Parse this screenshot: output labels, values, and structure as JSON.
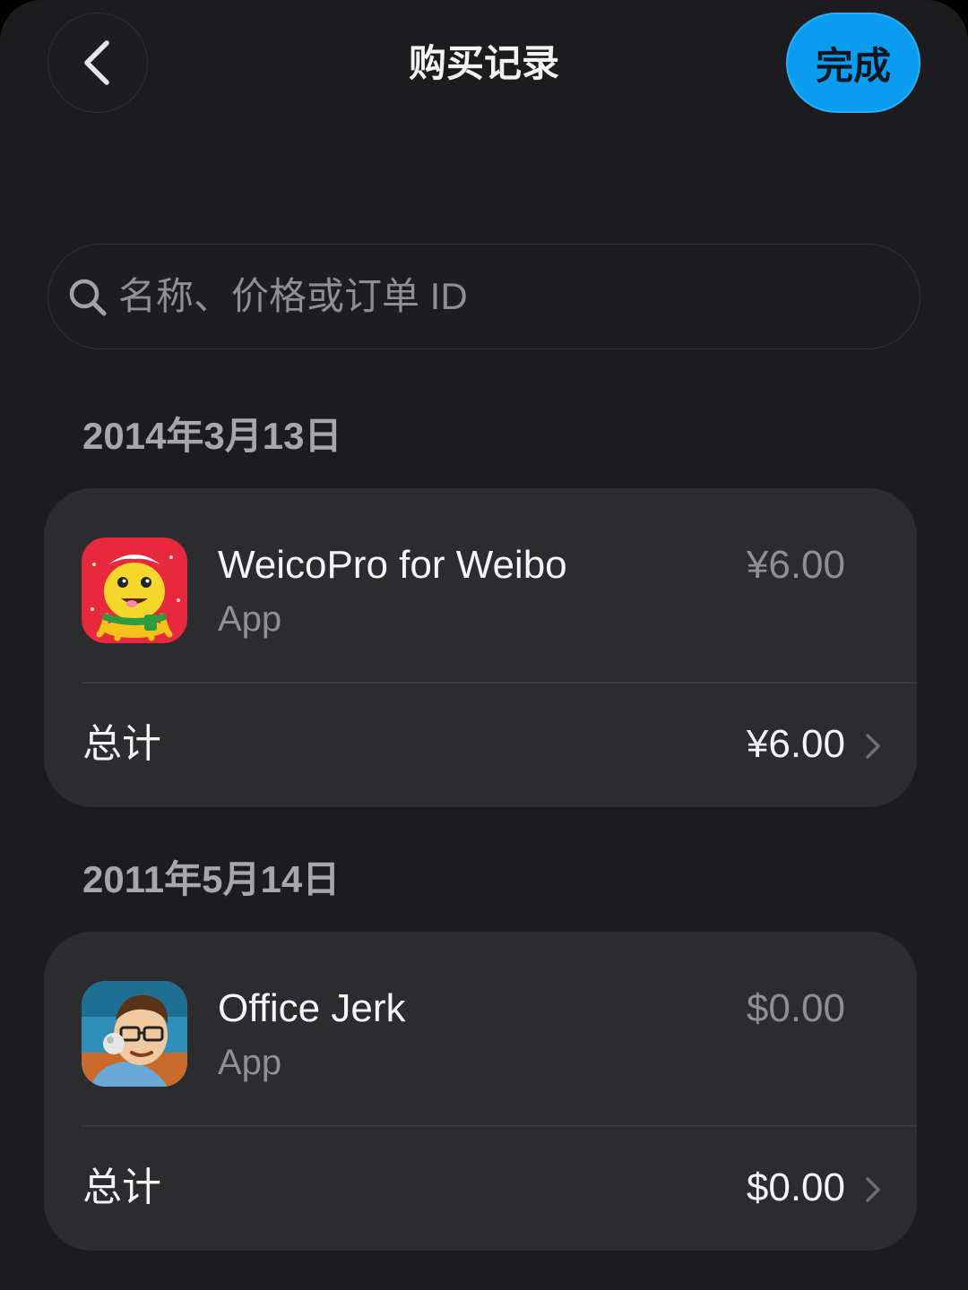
{
  "nav": {
    "title": "购买记录",
    "done_label": "完成"
  },
  "search": {
    "placeholder": "名称、价格或订单 ID"
  },
  "purchases": [
    {
      "date": "2014年3月13日",
      "app_name": "WeicoPro for Weibo",
      "app_kind": "App",
      "price": "¥6.00",
      "total_label": "总计",
      "total_value": "¥6.00",
      "icon": "weicopro-app-icon"
    },
    {
      "date": "2011年5月14日",
      "app_name": "Office Jerk",
      "app_kind": "App",
      "price": "$0.00",
      "total_label": "总计",
      "total_value": "$0.00",
      "icon": "office-jerk-app-icon"
    }
  ],
  "colors": {
    "background": "#1c1c1e",
    "card": "#2c2c2e",
    "accent": "#0a9cf0",
    "secondary_text": "#8e8e93"
  }
}
